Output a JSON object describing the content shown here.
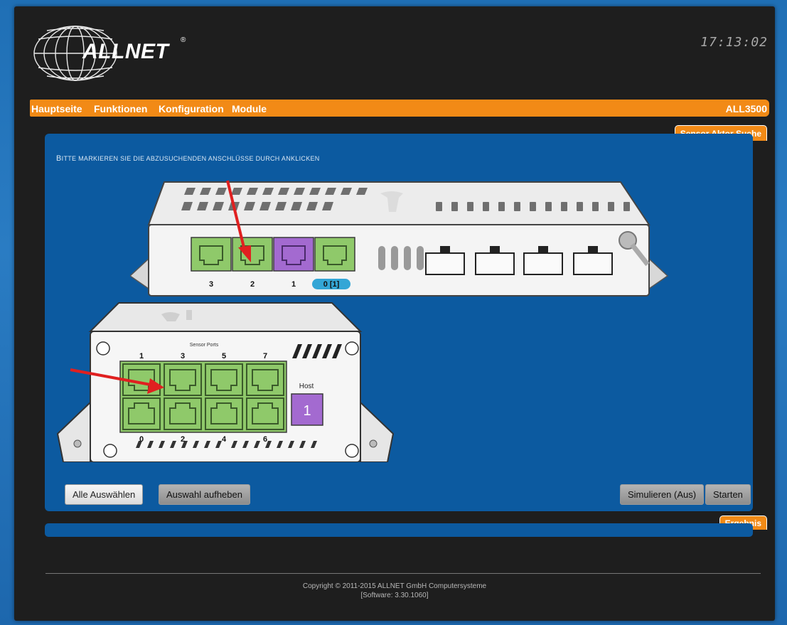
{
  "header": {
    "logo_text": "ALLNET",
    "logo_mark": "®",
    "clock": "17:13:02"
  },
  "nav": {
    "items": [
      {
        "label": "Hauptseite"
      },
      {
        "label": "Funktionen"
      },
      {
        "label": "Konfiguration"
      },
      {
        "label": "Module"
      }
    ],
    "model": "ALL3500"
  },
  "panel": {
    "tab_label": "Sensor Aktor Suche",
    "instruction": "Bitte markieren Sie die abzusuchenden Anschlüsse durch anklicken"
  },
  "main_device": {
    "ports": [
      {
        "label": "3",
        "color": "#8fc96a",
        "selected": false
      },
      {
        "label": "2",
        "color": "#8fc96a",
        "selected": false
      },
      {
        "label": "1",
        "color": "#a36ad0",
        "selected": false
      },
      {
        "label": "0 [1]",
        "color": "#8fc96a",
        "selected": true
      }
    ]
  },
  "sensor_device": {
    "title": "Sensor Ports",
    "top_labels": [
      "1",
      "3",
      "5",
      "7"
    ],
    "bottom_labels": [
      "0",
      "2",
      "4",
      "6"
    ],
    "host_label": "Host",
    "host_port": "1"
  },
  "colors": {
    "port_green": "#8fc96a",
    "port_purple": "#a36ad0",
    "accent_orange": "#f28a16",
    "panel_blue": "#0c5aa0",
    "arrow_red": "#e02020"
  },
  "buttons": {
    "select_all": "Alle Auswählen",
    "deselect": "Auswahl aufheben",
    "simulate": "Simulieren (Aus)",
    "start": "Starten"
  },
  "result": {
    "tab_label": "Ergebnis"
  },
  "footer": {
    "copyright": "Copyright © 2011-2015 ALLNET GmbH Computersysteme",
    "software": "[Software: 3.30.1060]"
  }
}
